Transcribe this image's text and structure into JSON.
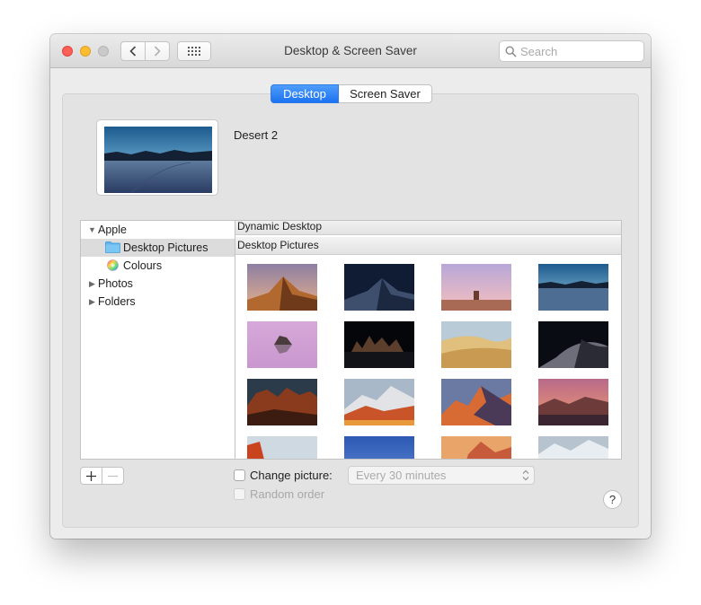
{
  "window": {
    "title": "Desktop & Screen Saver",
    "search_placeholder": "Search"
  },
  "tabs": [
    {
      "label": "Desktop",
      "active": true
    },
    {
      "label": "Screen Saver",
      "active": false
    }
  ],
  "current_picture": {
    "name": "Desert 2"
  },
  "sidebar": {
    "items": [
      {
        "label": "Apple",
        "expanded": true
      },
      {
        "label": "Desktop Pictures",
        "selected": true,
        "icon": "folder-icon"
      },
      {
        "label": "Colours",
        "icon": "color-wheel-icon"
      },
      {
        "label": "Photos",
        "expanded": false
      },
      {
        "label": "Folders",
        "expanded": false
      }
    ]
  },
  "content": {
    "section_dynamic": "Dynamic Desktop",
    "section_pictures": "Desktop Pictures"
  },
  "thumbnails": [
    {
      "name": "mojave-day"
    },
    {
      "name": "mojave-night"
    },
    {
      "name": "desert-rock-dusk"
    },
    {
      "name": "desert-lake-blue"
    },
    {
      "name": "mono-lake-pink"
    },
    {
      "name": "tufa-night"
    },
    {
      "name": "sand-dunes-day"
    },
    {
      "name": "sand-dunes-night"
    },
    {
      "name": "rock-cliffs"
    },
    {
      "name": "high-sierra-day"
    },
    {
      "name": "sierra-peaks-sunset"
    },
    {
      "name": "ridge-sunset"
    },
    {
      "name": "el-capitan"
    },
    {
      "name": "blue-sky"
    },
    {
      "name": "yosemite-sunset"
    },
    {
      "name": "mountain-snow"
    }
  ],
  "controls": {
    "change_picture_label": "Change picture:",
    "change_picture_checked": false,
    "interval_value": "Every 30 minutes",
    "random_order_label": "Random order",
    "random_order_checked": false,
    "help_label": "?"
  },
  "colors": {
    "accent": "#1c72f2",
    "close": "#fe5f57",
    "minimize": "#febc2e",
    "zoom_disabled": "#c9c9c9"
  }
}
